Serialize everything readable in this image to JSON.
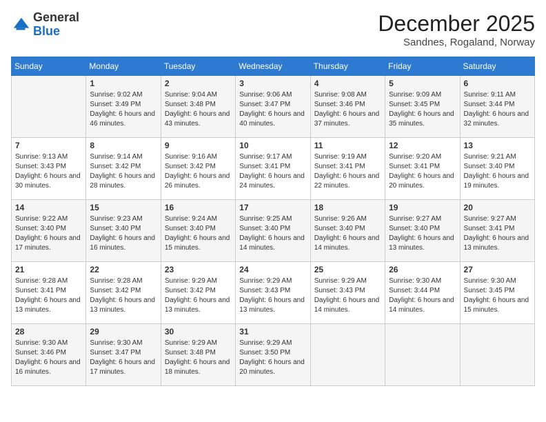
{
  "header": {
    "logo_line1": "General",
    "logo_line2": "Blue",
    "month_title": "December 2025",
    "subtitle": "Sandnes, Rogaland, Norway"
  },
  "weekdays": [
    "Sunday",
    "Monday",
    "Tuesday",
    "Wednesday",
    "Thursday",
    "Friday",
    "Saturday"
  ],
  "weeks": [
    [
      {
        "day": "",
        "info": ""
      },
      {
        "day": "1",
        "info": "Sunrise: 9:02 AM\nSunset: 3:49 PM\nDaylight: 6 hours\nand 46 minutes."
      },
      {
        "day": "2",
        "info": "Sunrise: 9:04 AM\nSunset: 3:48 PM\nDaylight: 6 hours\nand 43 minutes."
      },
      {
        "day": "3",
        "info": "Sunrise: 9:06 AM\nSunset: 3:47 PM\nDaylight: 6 hours\nand 40 minutes."
      },
      {
        "day": "4",
        "info": "Sunrise: 9:08 AM\nSunset: 3:46 PM\nDaylight: 6 hours\nand 37 minutes."
      },
      {
        "day": "5",
        "info": "Sunrise: 9:09 AM\nSunset: 3:45 PM\nDaylight: 6 hours\nand 35 minutes."
      },
      {
        "day": "6",
        "info": "Sunrise: 9:11 AM\nSunset: 3:44 PM\nDaylight: 6 hours\nand 32 minutes."
      }
    ],
    [
      {
        "day": "7",
        "info": "Sunrise: 9:13 AM\nSunset: 3:43 PM\nDaylight: 6 hours\nand 30 minutes."
      },
      {
        "day": "8",
        "info": "Sunrise: 9:14 AM\nSunset: 3:42 PM\nDaylight: 6 hours\nand 28 minutes."
      },
      {
        "day": "9",
        "info": "Sunrise: 9:16 AM\nSunset: 3:42 PM\nDaylight: 6 hours\nand 26 minutes."
      },
      {
        "day": "10",
        "info": "Sunrise: 9:17 AM\nSunset: 3:41 PM\nDaylight: 6 hours\nand 24 minutes."
      },
      {
        "day": "11",
        "info": "Sunrise: 9:19 AM\nSunset: 3:41 PM\nDaylight: 6 hours\nand 22 minutes."
      },
      {
        "day": "12",
        "info": "Sunrise: 9:20 AM\nSunset: 3:41 PM\nDaylight: 6 hours\nand 20 minutes."
      },
      {
        "day": "13",
        "info": "Sunrise: 9:21 AM\nSunset: 3:40 PM\nDaylight: 6 hours\nand 19 minutes."
      }
    ],
    [
      {
        "day": "14",
        "info": "Sunrise: 9:22 AM\nSunset: 3:40 PM\nDaylight: 6 hours\nand 17 minutes."
      },
      {
        "day": "15",
        "info": "Sunrise: 9:23 AM\nSunset: 3:40 PM\nDaylight: 6 hours\nand 16 minutes."
      },
      {
        "day": "16",
        "info": "Sunrise: 9:24 AM\nSunset: 3:40 PM\nDaylight: 6 hours\nand 15 minutes."
      },
      {
        "day": "17",
        "info": "Sunrise: 9:25 AM\nSunset: 3:40 PM\nDaylight: 6 hours\nand 14 minutes."
      },
      {
        "day": "18",
        "info": "Sunrise: 9:26 AM\nSunset: 3:40 PM\nDaylight: 6 hours\nand 14 minutes."
      },
      {
        "day": "19",
        "info": "Sunrise: 9:27 AM\nSunset: 3:40 PM\nDaylight: 6 hours\nand 13 minutes."
      },
      {
        "day": "20",
        "info": "Sunrise: 9:27 AM\nSunset: 3:41 PM\nDaylight: 6 hours\nand 13 minutes."
      }
    ],
    [
      {
        "day": "21",
        "info": "Sunrise: 9:28 AM\nSunset: 3:41 PM\nDaylight: 6 hours\nand 13 minutes."
      },
      {
        "day": "22",
        "info": "Sunrise: 9:28 AM\nSunset: 3:42 PM\nDaylight: 6 hours\nand 13 minutes."
      },
      {
        "day": "23",
        "info": "Sunrise: 9:29 AM\nSunset: 3:42 PM\nDaylight: 6 hours\nand 13 minutes."
      },
      {
        "day": "24",
        "info": "Sunrise: 9:29 AM\nSunset: 3:43 PM\nDaylight: 6 hours\nand 13 minutes."
      },
      {
        "day": "25",
        "info": "Sunrise: 9:29 AM\nSunset: 3:43 PM\nDaylight: 6 hours\nand 14 minutes."
      },
      {
        "day": "26",
        "info": "Sunrise: 9:30 AM\nSunset: 3:44 PM\nDaylight: 6 hours\nand 14 minutes."
      },
      {
        "day": "27",
        "info": "Sunrise: 9:30 AM\nSunset: 3:45 PM\nDaylight: 6 hours\nand 15 minutes."
      }
    ],
    [
      {
        "day": "28",
        "info": "Sunrise: 9:30 AM\nSunset: 3:46 PM\nDaylight: 6 hours\nand 16 minutes."
      },
      {
        "day": "29",
        "info": "Sunrise: 9:30 AM\nSunset: 3:47 PM\nDaylight: 6 hours\nand 17 minutes."
      },
      {
        "day": "30",
        "info": "Sunrise: 9:29 AM\nSunset: 3:48 PM\nDaylight: 6 hours\nand 18 minutes."
      },
      {
        "day": "31",
        "info": "Sunrise: 9:29 AM\nSunset: 3:50 PM\nDaylight: 6 hours\nand 20 minutes."
      },
      {
        "day": "",
        "info": ""
      },
      {
        "day": "",
        "info": ""
      },
      {
        "day": "",
        "info": ""
      }
    ]
  ]
}
